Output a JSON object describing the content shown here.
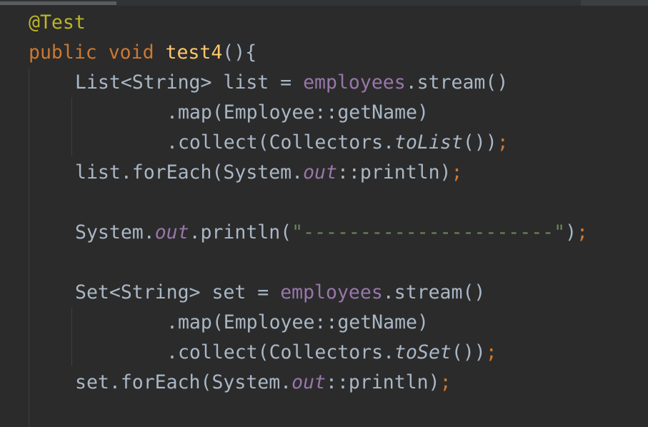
{
  "editor": {
    "lines": [
      {
        "tokens": [
          {
            "text": "@Test",
            "kind": "annotation"
          }
        ]
      },
      {
        "tokens": [
          {
            "text": "public",
            "kind": "keyword"
          },
          {
            "text": " ",
            "kind": "plain"
          },
          {
            "text": "void",
            "kind": "keyword"
          },
          {
            "text": " ",
            "kind": "plain"
          },
          {
            "text": "test4",
            "kind": "method-decl"
          },
          {
            "text": "(){",
            "kind": "plain"
          }
        ]
      },
      {
        "tokens": [
          {
            "text": "List<String> list = ",
            "kind": "plain"
          },
          {
            "text": "employees",
            "kind": "field"
          },
          {
            "text": ".stream()",
            "kind": "plain"
          }
        ]
      },
      {
        "tokens": [
          {
            "text": ".map(Employee::getName)",
            "kind": "plain"
          }
        ]
      },
      {
        "tokens": [
          {
            "text": ".collect(Collectors.",
            "kind": "plain"
          },
          {
            "text": "toList",
            "kind": "static-method"
          },
          {
            "text": "())",
            "kind": "plain"
          },
          {
            "text": ";",
            "kind": "semi"
          }
        ]
      },
      {
        "tokens": [
          {
            "text": "list.forEach(System.",
            "kind": "plain"
          },
          {
            "text": "out",
            "kind": "static-field"
          },
          {
            "text": "::println)",
            "kind": "plain"
          },
          {
            "text": ";",
            "kind": "semi"
          }
        ]
      },
      {
        "tokens": []
      },
      {
        "tokens": [
          {
            "text": "System.",
            "kind": "plain"
          },
          {
            "text": "out",
            "kind": "static-field"
          },
          {
            "text": ".println(",
            "kind": "plain"
          },
          {
            "text": "\"----------------------\"",
            "kind": "string"
          },
          {
            "text": ")",
            "kind": "plain"
          },
          {
            "text": ";",
            "kind": "semi"
          }
        ]
      },
      {
        "tokens": []
      },
      {
        "tokens": [
          {
            "text": "Set<String> set = ",
            "kind": "plain"
          },
          {
            "text": "employees",
            "kind": "field"
          },
          {
            "text": ".stream()",
            "kind": "plain"
          }
        ]
      },
      {
        "tokens": [
          {
            "text": ".map(Employee::getName)",
            "kind": "plain"
          }
        ]
      },
      {
        "tokens": [
          {
            "text": ".collect(Collectors.",
            "kind": "plain"
          },
          {
            "text": "toSet",
            "kind": "static-method"
          },
          {
            "text": "())",
            "kind": "plain"
          },
          {
            "text": ";",
            "kind": "semi"
          }
        ]
      },
      {
        "tokens": [
          {
            "text": "set.forEach(System.",
            "kind": "plain"
          },
          {
            "text": "out",
            "kind": "static-field"
          },
          {
            "text": "::println)",
            "kind": "plain"
          },
          {
            "text": ";",
            "kind": "semi"
          }
        ]
      }
    ]
  }
}
